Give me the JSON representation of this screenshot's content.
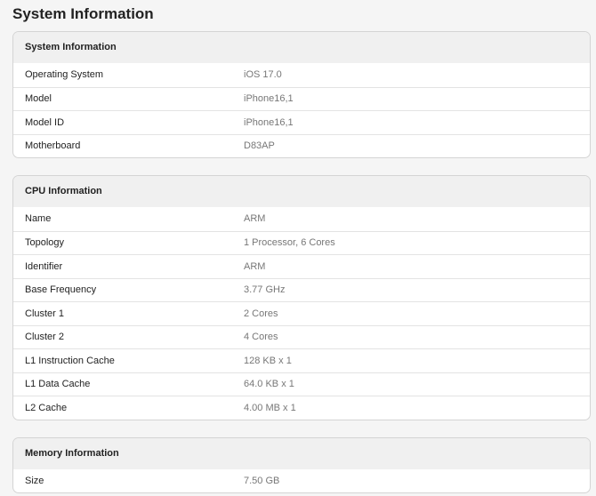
{
  "page": {
    "title": "System Information"
  },
  "sections": [
    {
      "header": "System Information",
      "rows": [
        {
          "label": "Operating System",
          "value": "iOS 17.0"
        },
        {
          "label": "Model",
          "value": "iPhone16,1"
        },
        {
          "label": "Model ID",
          "value": "iPhone16,1"
        },
        {
          "label": "Motherboard",
          "value": "D83AP"
        }
      ]
    },
    {
      "header": "CPU Information",
      "rows": [
        {
          "label": "Name",
          "value": "ARM"
        },
        {
          "label": "Topology",
          "value": "1 Processor, 6 Cores"
        },
        {
          "label": "Identifier",
          "value": "ARM"
        },
        {
          "label": "Base Frequency",
          "value": "3.77 GHz"
        },
        {
          "label": "Cluster 1",
          "value": "2 Cores"
        },
        {
          "label": "Cluster 2",
          "value": "4 Cores"
        },
        {
          "label": "L1 Instruction Cache",
          "value": "128 KB x 1"
        },
        {
          "label": "L1 Data Cache",
          "value": "64.0 KB x 1"
        },
        {
          "label": "L2 Cache",
          "value": "4.00 MB x 1"
        }
      ]
    },
    {
      "header": "Memory Information",
      "rows": [
        {
          "label": "Size",
          "value": "7.50 GB"
        }
      ]
    }
  ]
}
